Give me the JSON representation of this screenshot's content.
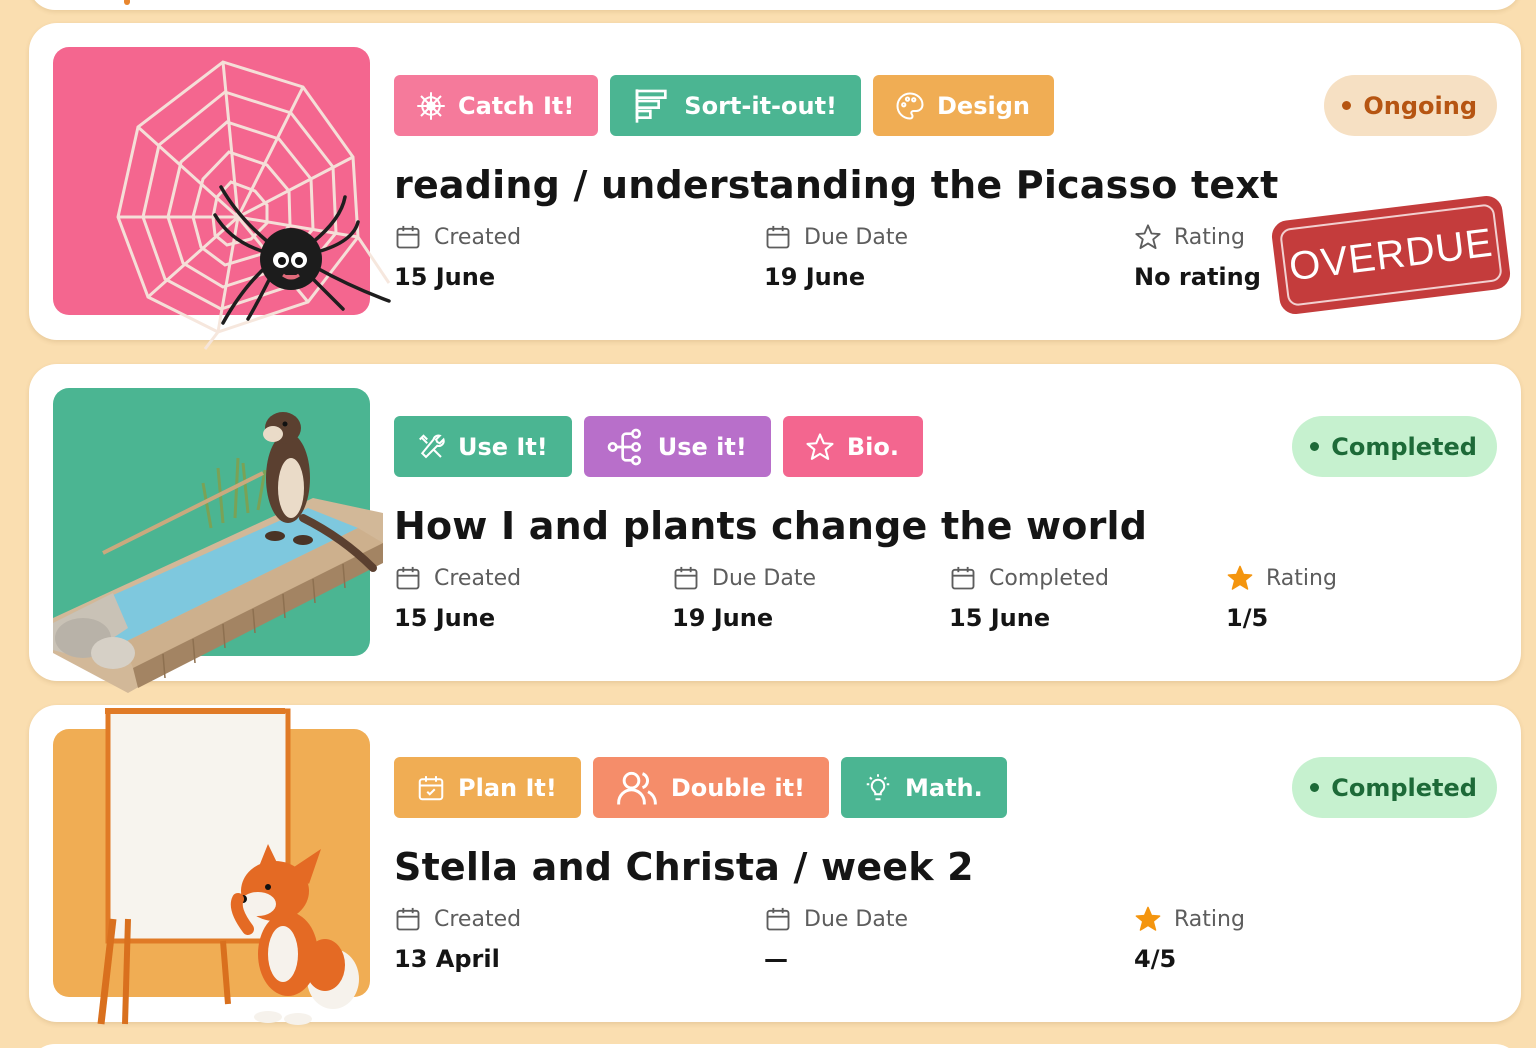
{
  "colors": {
    "page_bg": "#fadeb0",
    "pink": "#f57a9b",
    "teal": "#4bb592",
    "orange": "#f0ad54",
    "purple": "#b86fca",
    "hotpink": "#f3668f",
    "salmon": "#f58d6a",
    "ongoing_bg": "#f6e0c3",
    "ongoing_text": "#b65512",
    "completed_bg": "#c6f1cf",
    "completed_text": "#1d6a38",
    "star_filled": "#f4950e",
    "stamp_red": "#c43c3c"
  },
  "tasks": [
    {
      "tags": [
        {
          "label": "Catch It!",
          "icon": "spiderweb-icon",
          "color": "#f57a9b"
        },
        {
          "label": "Sort-it-out!",
          "icon": "sort-bars-icon",
          "color": "#4bb592"
        },
        {
          "label": "Design",
          "icon": "palette-icon",
          "color": "#f0ad54"
        }
      ],
      "status": "Ongoing",
      "title": "reading / understanding the Picasso text",
      "created_label": "Created",
      "created_value": "15 June",
      "due_label": "Due Date",
      "due_value": "19 June",
      "rating_label": "Rating",
      "rating_value": "No rating y",
      "stamp": "OVERDUE",
      "thumbnail": "spider-on-web"
    },
    {
      "tags": [
        {
          "label": "Use It!",
          "icon": "tools-icon",
          "color": "#4bb592"
        },
        {
          "label": "Use it!",
          "icon": "branch-icon",
          "color": "#b86fca"
        },
        {
          "label": "Bio.",
          "icon": "star-icon",
          "color": "#f3668f"
        }
      ],
      "status": "Completed",
      "title": "How I and plants change the world",
      "created_label": "Created",
      "created_value": "15 June",
      "due_label": "Due Date",
      "due_value": "19 June",
      "completed_label": "Completed",
      "completed_value": "15 June",
      "rating_label": "Rating",
      "rating_value": "1/5",
      "thumbnail": "otter-on-dam"
    },
    {
      "tags": [
        {
          "label": "Plan It!",
          "icon": "calendar-check-icon",
          "color": "#f0ad54"
        },
        {
          "label": "Double it!",
          "icon": "users-icon",
          "color": "#f58d6a"
        },
        {
          "label": "Math.",
          "icon": "lightbulb-icon",
          "color": "#4bb592"
        }
      ],
      "status": "Completed",
      "title": "Stella and Christa / week 2",
      "created_label": "Created",
      "created_value": "13 April",
      "due_label": "Due Date",
      "due_value": "—",
      "rating_label": "Rating",
      "rating_value": "4/5",
      "thumbnail": "fox-at-whiteboard"
    }
  ]
}
